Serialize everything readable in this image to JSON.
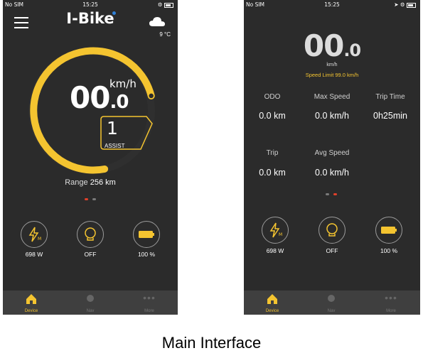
{
  "left": {
    "status": {
      "carrier": "No SIM",
      "time": "15:25"
    },
    "app_title": "I-Bike",
    "weather_temp": "9 °C",
    "speed_value": "00",
    "speed_decimal": ".0",
    "speed_unit": "km/h",
    "assist_level": "1",
    "assist_label": "ASSIST",
    "range_label": "Range",
    "range_value": "256 km",
    "power_value": "698 W",
    "light_value": "OFF",
    "battery_value": "100 %",
    "colors": {
      "accent": "#f4c430",
      "background": "#2b2b2b",
      "page_dot_active": "#e0402a"
    }
  },
  "right": {
    "status": {
      "carrier": "No SIM",
      "time": "15:25"
    },
    "speed_value": "00",
    "speed_decimal": ".0",
    "speed_unit": "km/h",
    "speed_limit": "Speed Limit 99.0 km/h",
    "stats": [
      {
        "label": "ODO",
        "value": "0.0 km"
      },
      {
        "label": "Max Speed",
        "value": "0.0 km/h"
      },
      {
        "label": "Trip Time",
        "value": "0h25min"
      },
      {
        "label": "Trip",
        "value": "0.0 km"
      },
      {
        "label": "Avg Speed",
        "value": "0.0 km/h"
      }
    ],
    "power_value": "698 W",
    "light_value": "OFF",
    "battery_value": "100 %"
  },
  "tabs": [
    {
      "label": "Device",
      "icon": "home-icon"
    },
    {
      "label": "Nav",
      "icon": "nav-icon"
    },
    {
      "label": "More",
      "icon": "more-icon"
    }
  ],
  "caption": "Main Interface"
}
